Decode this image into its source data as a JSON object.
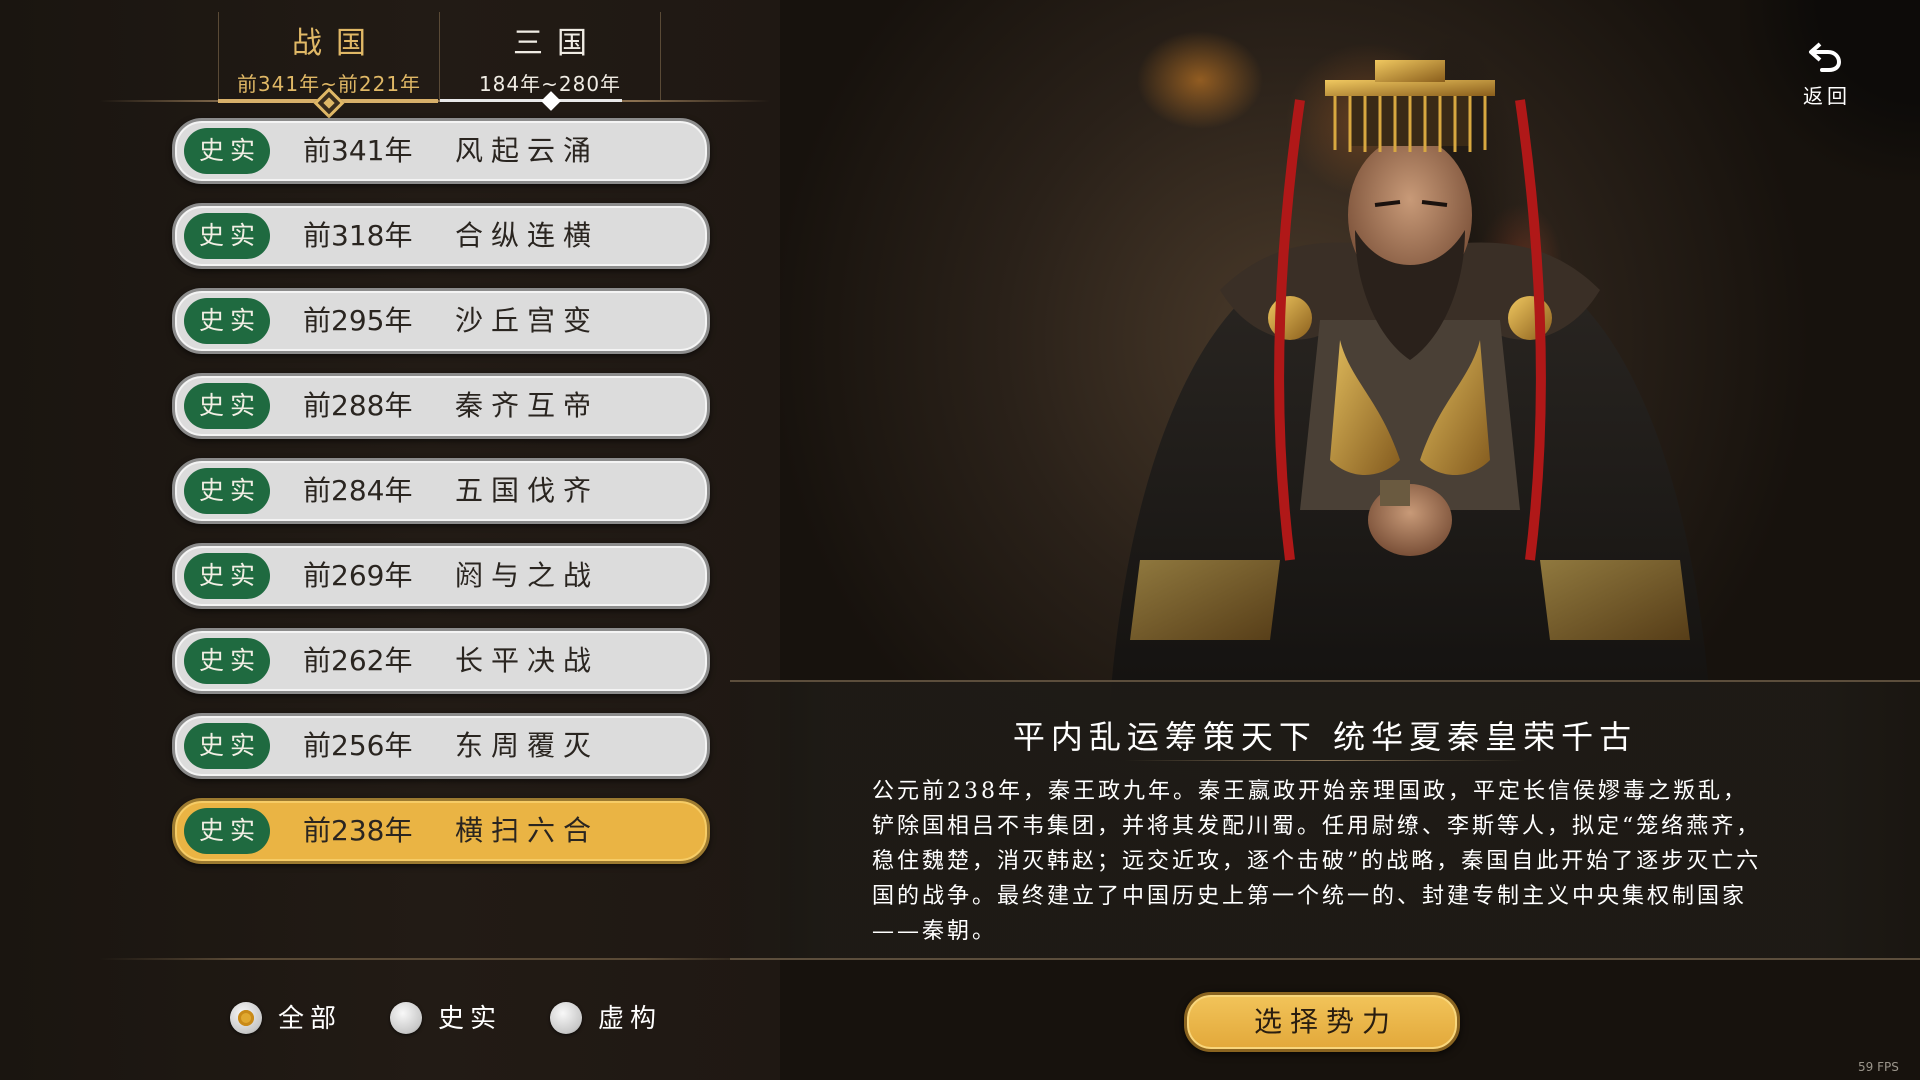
{
  "eras": [
    {
      "name": "战国",
      "range": "前341年~前221年",
      "active": true
    },
    {
      "name": "三国",
      "range": "184年~280年",
      "active": false
    }
  ],
  "events": [
    {
      "badge": "史实",
      "year": "前341年",
      "title": "风起云涌",
      "selected": false
    },
    {
      "badge": "史实",
      "year": "前318年",
      "title": "合纵连横",
      "selected": false
    },
    {
      "badge": "史实",
      "year": "前295年",
      "title": "沙丘宫变",
      "selected": false
    },
    {
      "badge": "史实",
      "year": "前288年",
      "title": "秦齐互帝",
      "selected": false
    },
    {
      "badge": "史实",
      "year": "前284年",
      "title": "五国伐齐",
      "selected": false
    },
    {
      "badge": "史实",
      "year": "前269年",
      "title": "阏与之战",
      "selected": false
    },
    {
      "badge": "史实",
      "year": "前262年",
      "title": "长平决战",
      "selected": false
    },
    {
      "badge": "史实",
      "year": "前256年",
      "title": "东周覆灭",
      "selected": false
    },
    {
      "badge": "史实",
      "year": "前238年",
      "title": "横扫六合",
      "selected": true
    }
  ],
  "filters": [
    {
      "label": "全部",
      "selected": true
    },
    {
      "label": "史实",
      "selected": false
    },
    {
      "label": "虚构",
      "selected": false
    }
  ],
  "back": {
    "label": "返回",
    "icon": "back-arrow-icon"
  },
  "description": {
    "title": "平内乱运筹策天下 统华夏秦皇荣千古",
    "body": "公元前238年，秦王政九年。秦王嬴政开始亲理国政，平定长信侯嫪毒之叛乱，铲除国相吕不韦集团，并将其发配川蜀。任用尉缭、李斯等人，拟定“笼络燕齐，稳住魏楚，消灭韩赵；远交近攻，逐个击破”的战略，秦国自此开始了逐步灭亡六国的战争。最终建立了中国历史上第一个统一的、封建专制主义中央集权制国家——秦朝。"
  },
  "select_button": {
    "label": "选择势力"
  },
  "fps": "59 FPS",
  "colors": {
    "accent_gold": "#e0b866",
    "badge_green": "#1f6a40",
    "selected_item": "#eab444",
    "item_bg": "#dcdcdc"
  }
}
